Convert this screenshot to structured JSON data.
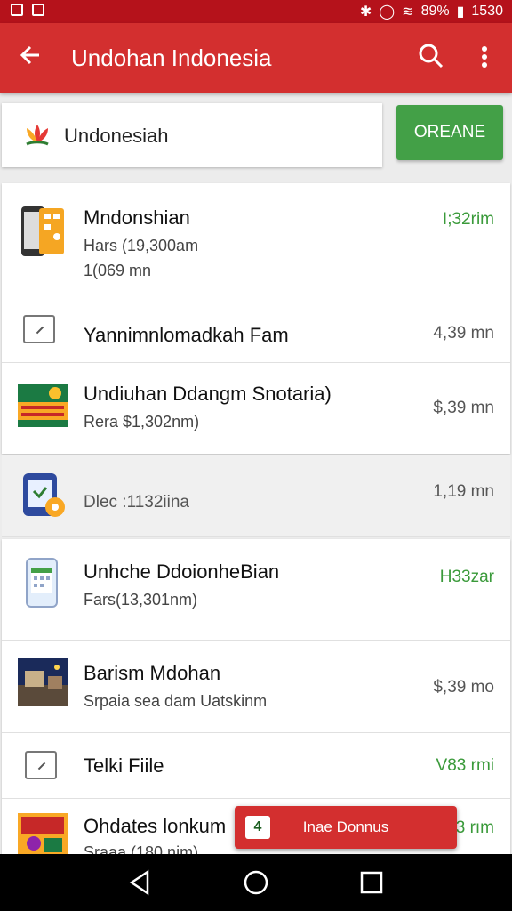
{
  "status_bar": {
    "battery": "89%",
    "time": "1530"
  },
  "app_bar": {
    "title": "Undohan Indonesia"
  },
  "search": {
    "value": "Undonesiah"
  },
  "action_button": {
    "label": "OREANE"
  },
  "items": [
    {
      "title": "Mndonshian",
      "line2": "Hars (19,300am",
      "line3": "1(069 mn",
      "price": "I;32rim",
      "price_color": "green",
      "icon": "phone-app-icon"
    },
    {
      "title": "Yannimnlomadkah Fam",
      "price": "4,39 mn",
      "price_color": "grey",
      "icon": "checkbox-icon"
    },
    {
      "title": "Undiuhan Ddangm Snotaria)",
      "line2": "Rera $1,302nm)",
      "price": "$,39 mn",
      "price_color": "grey",
      "icon": "banner-thumbnail-icon"
    },
    {
      "title": "Dlec :1132iina",
      "price": "1,19 mn",
      "price_color": "grey",
      "icon": "phone-badge-icon"
    },
    {
      "title": "Unhche DdoionheBian",
      "line2": "Fars(13,301nm)",
      "price": "H33zar",
      "price_color": "green",
      "icon": "phone-calendar-icon"
    },
    {
      "title": "Barism Mdohan",
      "line2": "Srpaia sea dam Uatskinm",
      "price": "$,39 mo",
      "price_color": "grey",
      "icon": "photo-thumbnail-icon"
    },
    {
      "title": "Telki Fiile",
      "price": "V83 rmi",
      "price_color": "green",
      "icon": "checkbox-icon"
    },
    {
      "title": "Ohdates lonkum",
      "line2": "Sraaa (180 nim)",
      "price": "3 rım",
      "price_color": "green",
      "icon": "poster-thumbnail-icon"
    }
  ],
  "snackbar": {
    "label": "Inae Donnus",
    "icon_glyph": "4"
  },
  "colors": {
    "primary": "#d32f2f",
    "status": "#b5121b",
    "accent_green": "#43a047"
  }
}
